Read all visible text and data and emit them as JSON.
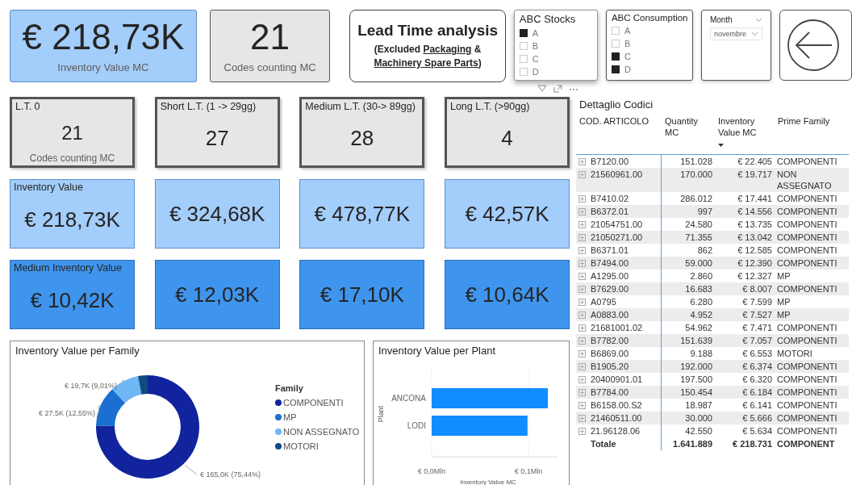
{
  "header": {
    "kpis": [
      {
        "kind": "light",
        "value": "€ 218,73K",
        "label": "Inventory Value MC"
      },
      {
        "kind": "grey",
        "value": "21",
        "label": "Codes counting MC"
      }
    ],
    "title": {
      "heading": "Lead Time analysis",
      "note": "(Excluded **Packaging** & **Machinery Spare Parts**)"
    },
    "slicers": [
      {
        "title": "ABC Stocks",
        "focused": true,
        "items": [
          {
            "label": "A",
            "checked": true
          },
          {
            "label": "B",
            "checked": false
          },
          {
            "label": "C",
            "checked": false
          },
          {
            "label": "D",
            "checked": false
          }
        ]
      },
      {
        "title": "ABC Consumption",
        "focused": false,
        "items": [
          {
            "label": "A",
            "checked": false
          },
          {
            "label": "B",
            "checked": false
          },
          {
            "label": "C",
            "checked": true
          },
          {
            "label": "D",
            "checked": true
          }
        ]
      }
    ],
    "month": {
      "title": "Month",
      "value": "novembre"
    }
  },
  "card_rows": [
    {
      "kind": "grey",
      "cards": [
        {
          "title": "L.T. 0",
          "value": "21",
          "label": "Codes counting MC"
        },
        {
          "title": "Short L.T. (1 -> 29gg)",
          "value": "27"
        },
        {
          "title": "Medium L.T. (30-> 89gg)",
          "value": "28"
        },
        {
          "title": "Long L.T. (>90gg)",
          "value": "4"
        }
      ]
    },
    {
      "kind": "light",
      "cards": [
        {
          "title": "Inventory Value",
          "value": "€ 218,73K"
        },
        {
          "value": "€ 324,68K"
        },
        {
          "value": "€ 478,77K"
        },
        {
          "value": "€ 42,57K"
        }
      ]
    },
    {
      "kind": "mid",
      "cards": [
        {
          "title": "Medium Inventory Value",
          "value": "€ 10,42K"
        },
        {
          "value": "€ 12,03K"
        },
        {
          "value": "€ 17,10K"
        },
        {
          "value": "€ 10,64K"
        }
      ]
    }
  ],
  "family_chart": {
    "title": "Inventory Value per Family",
    "legend_title": "Family",
    "legend": [
      {
        "color": "#12239e"
      },
      {
        "color": "#1a6fd0"
      },
      {
        "color": "#6fb6f5"
      },
      {
        "color": "#0d4c80"
      }
    ],
    "chart_data": {
      "type": "donut",
      "categories": [
        "COMPONENTI",
        "MP",
        "NON ASSEGNATO",
        "MOTORI"
      ],
      "values": [
        165000,
        27500,
        19700,
        6530
      ],
      "value_labels": [
        "€ 165,0K (75,44%)",
        "€ 27,5K (12,55%)",
        "€ 19,7K (9,01%)",
        null
      ]
    }
  },
  "plant_chart": {
    "title": "Inventory Value per Plant",
    "chart_data": {
      "type": "bar",
      "orientation": "horizontal",
      "ylabel": "Plant",
      "xlabel": "Inventory Value MC",
      "categories": [
        "ANCONA",
        "LODI"
      ],
      "values": [
        0.12,
        0.099
      ],
      "xlim": [
        0,
        0.13
      ],
      "xticks": [
        {
          "value": 0,
          "label": "€ 0,0Mln"
        },
        {
          "value": 0.1,
          "label": "€ 0,1Mln"
        }
      ]
    }
  },
  "table": {
    "title": "Dettaglio Codici",
    "columns": [
      {
        "label": "COD. ARTICOLO",
        "sorted": false
      },
      {
        "label": "Quantity MC",
        "sorted": false
      },
      {
        "label": "Inventory Value MC",
        "sorted": true
      },
      {
        "label": "Prime Family",
        "sorted": false
      }
    ],
    "rows": [
      [
        "B7120.00",
        "151.028",
        "€ 22.405",
        "COMPONENTI"
      ],
      [
        "21560961.00",
        "170.000",
        "€ 19.717",
        "NON ASSEGNATO"
      ],
      [
        "B7410.02",
        "286.012",
        "€ 17.441",
        "COMPONENTI"
      ],
      [
        "B6372.01",
        "997",
        "€ 14.556",
        "COMPONENTI"
      ],
      [
        "21054751.00",
        "24.580",
        "€ 13.735",
        "COMPONENTI"
      ],
      [
        "21050271.00",
        "71.355",
        "€ 13.042",
        "COMPONENTI"
      ],
      [
        "B6371.01",
        "862",
        "€ 12.585",
        "COMPONENTI"
      ],
      [
        "B7494.00",
        "59.000",
        "€ 12.390",
        "COMPONENTI"
      ],
      [
        "A1295.00",
        "2.860",
        "€ 12.327",
        "MP"
      ],
      [
        "B7629.00",
        "16.683",
        "€ 8.007",
        "COMPONENTI"
      ],
      [
        "A0795",
        "6.280",
        "€ 7.599",
        "MP"
      ],
      [
        "A0883.00",
        "4.952",
        "€ 7.527",
        "MP"
      ],
      [
        "21681001.02",
        "54.962",
        "€ 7.471",
        "COMPONENTI"
      ],
      [
        "B7782.00",
        "151.639",
        "€ 7.057",
        "COMPONENTI"
      ],
      [
        "B6869.00",
        "9.188",
        "€ 6.553",
        "MOTORI"
      ],
      [
        "B1905.20",
        "192.000",
        "€ 6.374",
        "COMPONENTI"
      ],
      [
        "20400901.01",
        "197.500",
        "€ 6.320",
        "COMPONENTI"
      ],
      [
        "B7784.00",
        "150.454",
        "€ 6.184",
        "COMPONENTI"
      ],
      [
        "B6158.00.S2",
        "18.987",
        "€ 6.141",
        "COMPONENTI"
      ],
      [
        "21460511.00",
        "30.000",
        "€ 5.666",
        "COMPONENTI"
      ],
      [
        "21.96128.06",
        "42.550",
        "€ 5.634",
        "COMPONENTI"
      ]
    ],
    "total": [
      "Totale",
      "1.641.889",
      "€ 218.731",
      "COMPONENT"
    ]
  }
}
